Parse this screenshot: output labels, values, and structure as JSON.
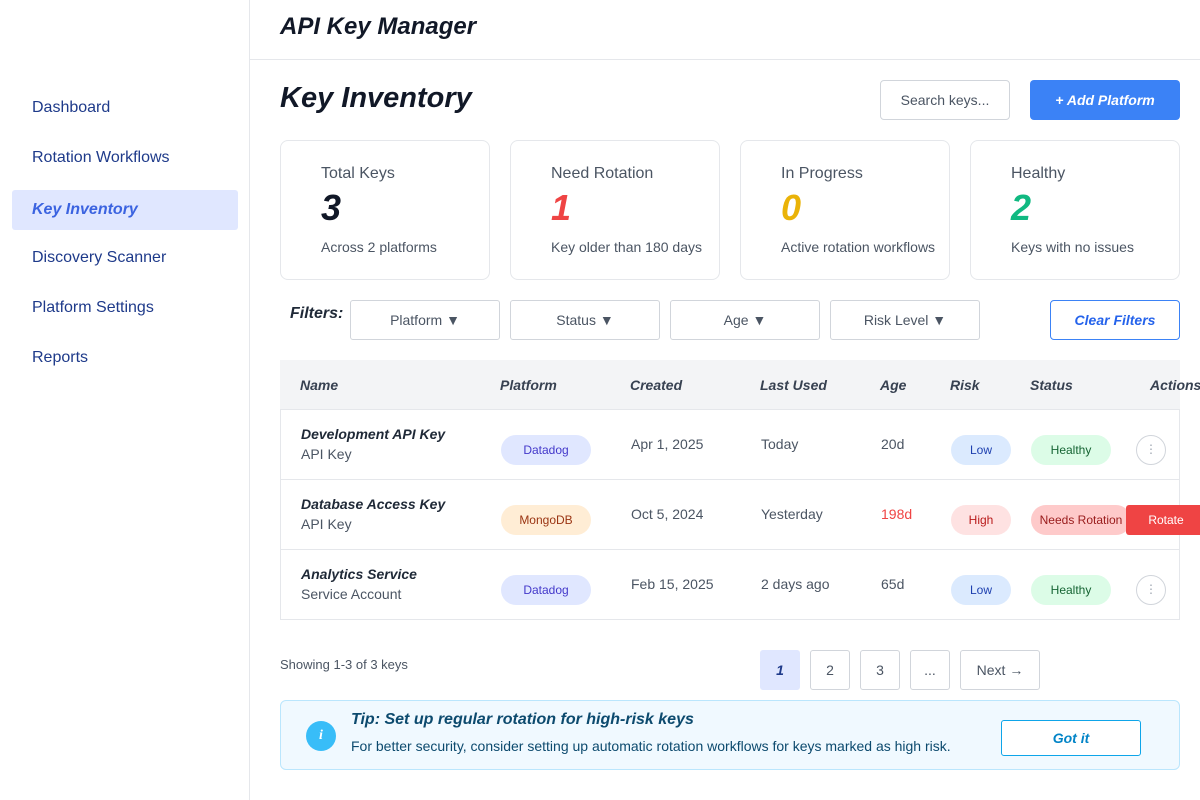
{
  "app": {
    "title": "API Key Manager"
  },
  "sidebar": {
    "items": [
      {
        "label": "Dashboard",
        "active": false
      },
      {
        "label": "Rotation Workflows",
        "active": false
      },
      {
        "label": "Key Inventory",
        "active": true
      },
      {
        "label": "Discovery Scanner",
        "active": false
      },
      {
        "label": "Platform Settings",
        "active": false
      },
      {
        "label": "Reports",
        "active": false
      }
    ]
  },
  "page": {
    "title": "Key Inventory",
    "search_placeholder": "Search keys...",
    "add_button": "+ Add Platform"
  },
  "stats": [
    {
      "label": "Total Keys",
      "value": "3",
      "sub": "Across 2 platforms",
      "color": "#111827"
    },
    {
      "label": "Need Rotation",
      "value": "1",
      "sub": "Key older than 180 days",
      "color": "#ef4444"
    },
    {
      "label": "In Progress",
      "value": "0",
      "sub": "Active rotation workflows",
      "color": "#eab308"
    },
    {
      "label": "Healthy",
      "value": "2",
      "sub": "Keys with no issues",
      "color": "#10b981"
    }
  ],
  "filters": {
    "label": "Filters:",
    "items": [
      "Platform ▼",
      "Status ▼",
      "Age ▼",
      "Risk Level ▼"
    ],
    "clear": "Clear Filters"
  },
  "table": {
    "columns": [
      "Name",
      "Platform",
      "Created",
      "Last Used",
      "Age",
      "Risk",
      "Status",
      "Actions"
    ],
    "rows": [
      {
        "name": "Development API Key",
        "type": "API Key",
        "platform": "Datadog",
        "created": "Apr 1, 2025",
        "last_used": "Today",
        "age": "20d",
        "age_alert": false,
        "risk": "Low",
        "status": "Healthy",
        "action": "more",
        "action_icon": "⋮"
      },
      {
        "name": "Database Access Key",
        "type": "API Key",
        "platform": "MongoDB",
        "created": "Oct 5, 2024",
        "last_used": "Yesterday",
        "age": "198d",
        "age_alert": true,
        "risk": "High",
        "status": "Needs Rotation",
        "action": "rotate",
        "action_label": "Rotate"
      },
      {
        "name": "Analytics Service",
        "type": "Service Account",
        "platform": "Datadog",
        "created": "Feb 15, 2025",
        "last_used": "2 days ago",
        "age": "65d",
        "age_alert": false,
        "risk": "Low",
        "status": "Healthy",
        "action": "more",
        "action_icon": "⋮"
      }
    ]
  },
  "pagination": {
    "showing": "Showing 1-3 of 3 keys",
    "pages": [
      "1",
      "2",
      "3",
      "..."
    ],
    "current": "1",
    "next": "Next →"
  },
  "tip": {
    "icon": "i",
    "title": "Tip: Set up regular rotation for high-risk keys",
    "text": "For better security, consider setting up automatic rotation workflows for keys marked as high risk.",
    "button": "Got it"
  },
  "colors": {
    "accent": "#3b82f6",
    "datadog_bg": "#e0e7ff",
    "datadog_fg": "#4338ca",
    "mongodb_bg": "#ffedd5",
    "mongodb_fg": "#9a3412",
    "low_bg": "#dbeafe",
    "low_fg": "#1e40af",
    "high_bg": "#fee2e2",
    "high_fg": "#b91c1c",
    "healthy_bg": "#dcfce7",
    "healthy_fg": "#166534",
    "rotation_bg": "#fecaca",
    "rotation_fg": "#991b1b",
    "danger": "#ef4444"
  }
}
